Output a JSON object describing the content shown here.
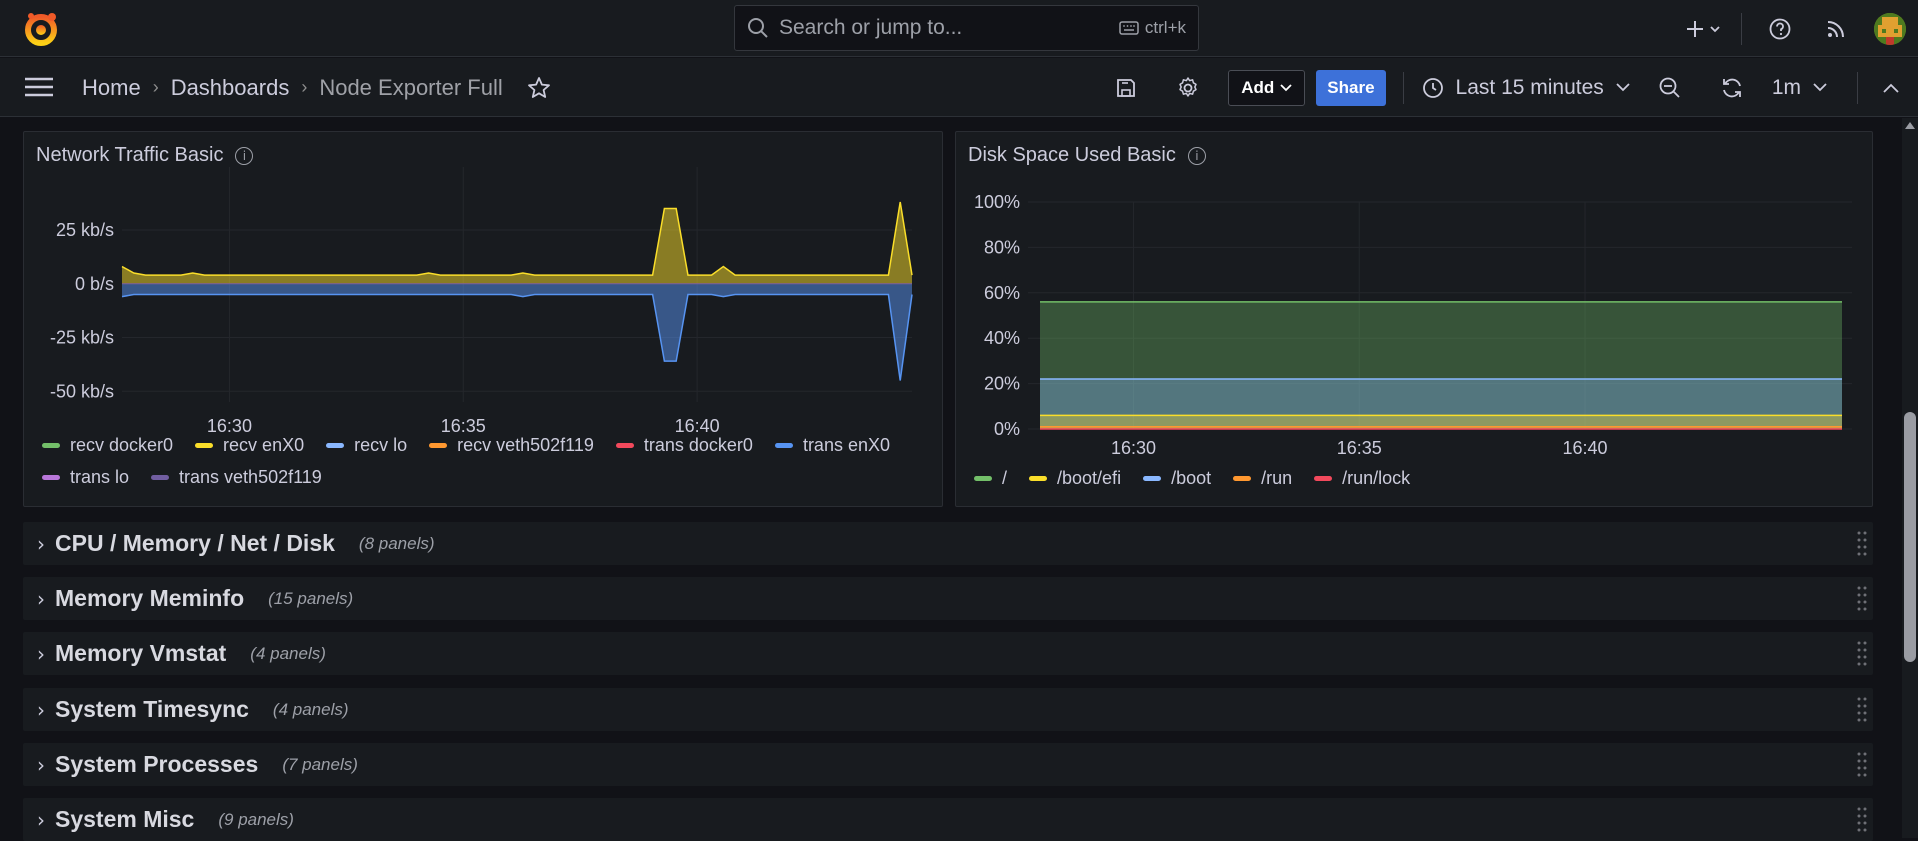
{
  "search": {
    "placeholder": "Search or jump to...",
    "shortcut": "ctrl+k"
  },
  "breadcrumb": {
    "home": "Home",
    "dashboards": "Dashboards",
    "current": "Node Exporter Full"
  },
  "toolbar": {
    "add_label": "Add",
    "share_label": "Share",
    "time_range": "Last 15 minutes",
    "refresh_interval": "1m"
  },
  "panels": {
    "network": {
      "title": "Network Traffic Basic",
      "legend": [
        {
          "label": "recv docker0",
          "color": "#73bf69"
        },
        {
          "label": "recv enX0",
          "color": "#fade2a"
        },
        {
          "label": "recv lo",
          "color": "#8ab8ff"
        },
        {
          "label": "recv veth502f119",
          "color": "#ff9830"
        },
        {
          "label": "trans docker0",
          "color": "#f2495c"
        },
        {
          "label": "trans enX0",
          "color": "#5794f2"
        },
        {
          "label": "trans lo",
          "color": "#b877d9"
        },
        {
          "label": "trans veth502f119",
          "color": "#705da0"
        }
      ]
    },
    "disk": {
      "title": "Disk Space Used Basic",
      "legend": [
        {
          "label": "/",
          "color": "#73bf69"
        },
        {
          "label": "/boot/efi",
          "color": "#fade2a"
        },
        {
          "label": "/boot",
          "color": "#8ab8ff"
        },
        {
          "label": "/run",
          "color": "#ff9830"
        },
        {
          "label": "/run/lock",
          "color": "#f2495c"
        }
      ]
    }
  },
  "chart_data": [
    {
      "type": "area",
      "title": "Network Traffic Basic",
      "x_ticks": [
        "16:30",
        "16:35",
        "16:40"
      ],
      "y_ticks": [
        "25 kb/s",
        "0 b/s",
        "-25 kb/s",
        "-50 kb/s"
      ],
      "ylim": [
        -55,
        45
      ],
      "x": [
        0,
        1,
        2,
        3,
        4,
        5,
        6,
        7,
        8,
        9,
        10,
        11,
        12,
        13,
        14,
        15,
        16,
        17,
        18,
        19,
        20,
        21,
        22,
        23,
        24,
        25,
        26,
        27,
        28,
        29,
        30,
        31,
        32,
        33,
        34,
        35,
        36,
        37,
        38,
        39,
        40,
        41,
        42,
        43,
        44,
        45,
        46,
        47,
        48,
        49,
        50,
        51,
        52,
        53,
        54,
        55,
        56,
        57,
        58,
        59,
        60,
        61,
        62,
        63,
        64,
        65,
        66,
        67
      ],
      "series": [
        {
          "name": "recv enX0",
          "values": [
            8,
            5,
            4,
            4,
            4,
            4,
            5,
            4,
            4,
            4,
            4,
            4,
            4,
            4,
            4,
            4,
            4,
            4,
            4,
            4,
            4,
            4,
            4,
            4,
            4,
            4,
            5,
            4,
            4,
            4,
            4,
            4,
            4,
            4,
            5,
            4,
            4,
            4,
            4,
            4,
            4,
            4,
            4,
            4,
            4,
            4,
            35,
            35,
            4,
            4,
            4,
            8,
            4,
            4,
            4,
            4,
            4,
            4,
            4,
            4,
            4,
            4,
            4,
            4,
            4,
            4,
            38,
            4
          ]
        },
        {
          "name": "trans enX0",
          "values": [
            -6,
            -5,
            -5,
            -5,
            -5,
            -5,
            -5,
            -5,
            -5,
            -5,
            -5,
            -5,
            -5,
            -5,
            -5,
            -5,
            -5,
            -5,
            -5,
            -5,
            -5,
            -5,
            -5,
            -5,
            -5,
            -5,
            -5,
            -5,
            -5,
            -5,
            -5,
            -5,
            -5,
            -5,
            -6,
            -5,
            -5,
            -5,
            -5,
            -5,
            -5,
            -5,
            -5,
            -5,
            -5,
            -5,
            -36,
            -36,
            -5,
            -5,
            -5,
            -6,
            -5,
            -5,
            -5,
            -5,
            -5,
            -5,
            -5,
            -5,
            -5,
            -5,
            -5,
            -5,
            -5,
            -5,
            -45,
            -5
          ]
        }
      ]
    },
    {
      "type": "area",
      "title": "Disk Space Used Basic",
      "x_ticks": [
        "16:30",
        "16:35",
        "16:40"
      ],
      "y_ticks": [
        "100%",
        "80%",
        "60%",
        "40%",
        "20%",
        "0%"
      ],
      "ylim": [
        0,
        100
      ],
      "series": [
        {
          "name": "/",
          "value": 56
        },
        {
          "name": "/boot",
          "value": 22
        },
        {
          "name": "/boot/efi",
          "value": 6
        },
        {
          "name": "/run",
          "value": 1
        },
        {
          "name": "/run/lock",
          "value": 0
        }
      ]
    }
  ],
  "rows": [
    {
      "title": "CPU / Memory / Net / Disk",
      "count": "(8 panels)"
    },
    {
      "title": "Memory Meminfo",
      "count": "(15 panels)"
    },
    {
      "title": "Memory Vmstat",
      "count": "(4 panels)"
    },
    {
      "title": "System Timesync",
      "count": "(4 panels)"
    },
    {
      "title": "System Processes",
      "count": "(7 panels)"
    },
    {
      "title": "System Misc",
      "count": "(9 panels)"
    }
  ]
}
